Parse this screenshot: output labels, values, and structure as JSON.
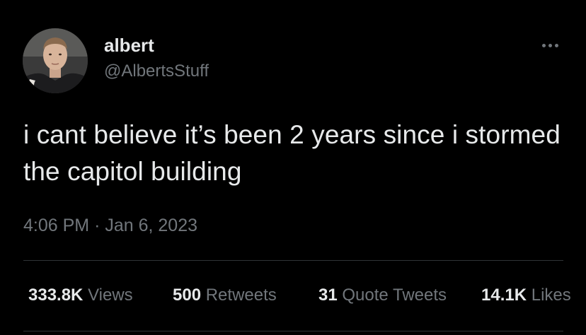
{
  "author": {
    "display_name": "albert",
    "handle": "@AlbertsStuff",
    "avatar_icon": "profile-photo"
  },
  "menu": {
    "icon": "more-options-icon"
  },
  "tweet": {
    "text": "i cant believe it’s been 2 years since i stormed the capitol building",
    "time": "4:06 PM",
    "separator": "·",
    "date": "Jan 6, 2023"
  },
  "stats": {
    "views_count": "333.8K",
    "views_label": "Views",
    "retweets_count": "500",
    "retweets_label": "Retweets",
    "quotes_count": "31",
    "quotes_label": "Quote Tweets",
    "likes_count": "14.1K",
    "likes_label": "Likes"
  },
  "colors": {
    "background": "#000000",
    "primary_text": "#e7e9ea",
    "secondary_text": "#71767b",
    "divider": "#2f3336"
  }
}
